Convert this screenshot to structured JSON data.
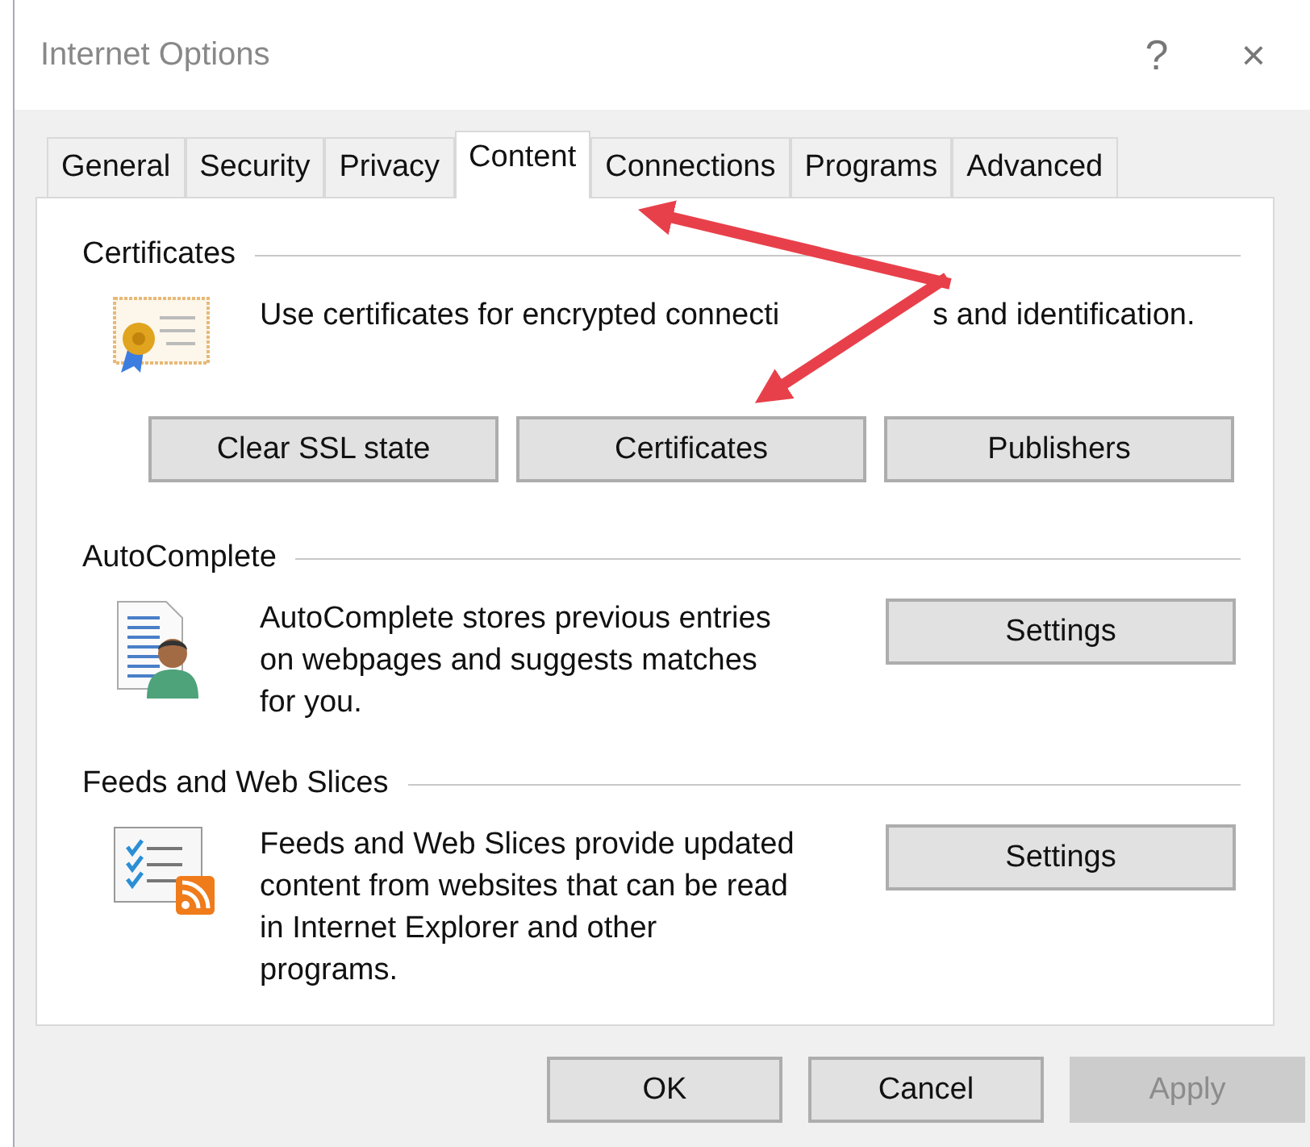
{
  "window": {
    "title": "Internet Options",
    "help": "?",
    "close": "×"
  },
  "tabs": [
    {
      "label": "General",
      "selected": false
    },
    {
      "label": "Security",
      "selected": false
    },
    {
      "label": "Privacy",
      "selected": false
    },
    {
      "label": "Content",
      "selected": true
    },
    {
      "label": "Connections",
      "selected": false
    },
    {
      "label": "Programs",
      "selected": false
    },
    {
      "label": "Advanced",
      "selected": false
    }
  ],
  "sections": [
    {
      "kind": "certificates",
      "title": "Certificates",
      "description_parts": [
        "Use certificates for encrypted connecti",
        "s and identification."
      ],
      "buttons": [
        "Clear SSL state",
        "Certificates",
        "Publishers"
      ]
    },
    {
      "kind": "autocomplete",
      "title": "AutoComplete",
      "description": "AutoComplete stores previous entries on webpages and suggests matches for you.",
      "buttons": [
        "Settings"
      ]
    },
    {
      "kind": "feeds",
      "title": "Feeds and Web Slices",
      "description": "Feeds and Web Slices provide updated content from websites that can be read in Internet Explorer and other programs.",
      "buttons": [
        "Settings"
      ]
    }
  ],
  "footer_buttons": [
    {
      "label": "OK",
      "disabled": false
    },
    {
      "label": "Cancel",
      "disabled": false
    },
    {
      "label": "Apply",
      "disabled": true
    }
  ]
}
